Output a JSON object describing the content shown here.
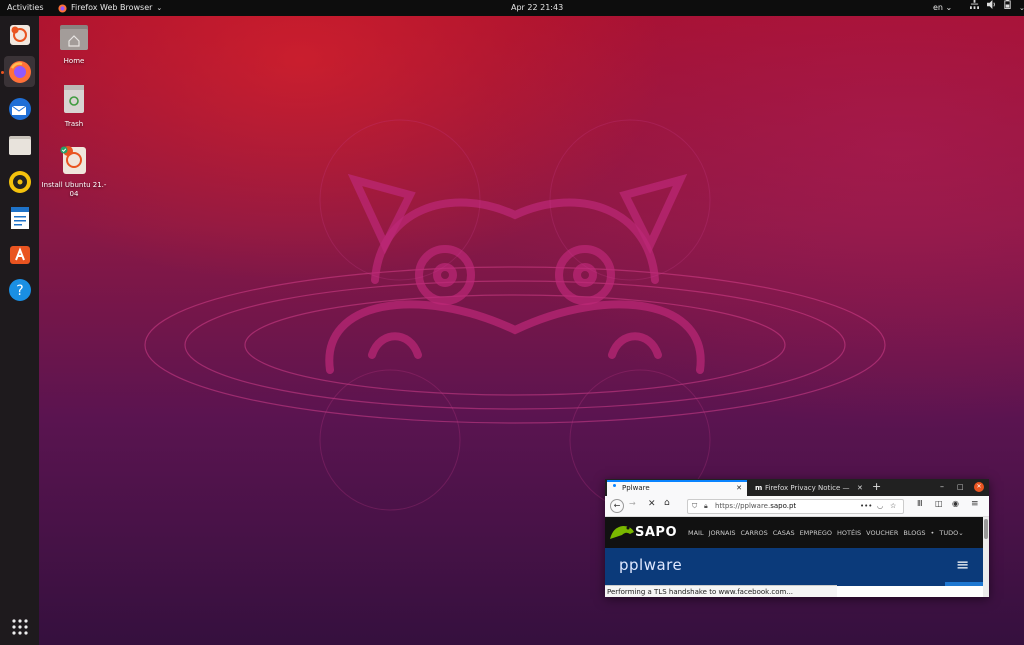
{
  "topbar": {
    "activities": "Activities",
    "app_name": "Firefox Web Browser",
    "clock": "Apr 22  21:43",
    "language": "en"
  },
  "desktop": {
    "icons": [
      {
        "label": "Home",
        "icon": "folder-home-icon"
      },
      {
        "label": "Trash",
        "icon": "trash-icon"
      },
      {
        "label": "Install Ubuntu 21.-\n04",
        "icon": "ubuntu-installer-icon"
      }
    ]
  },
  "dock": {
    "items": [
      "ubuntu-installer",
      "firefox",
      "thunderbird",
      "files",
      "rhythmbox",
      "libreoffice-writer",
      "ubuntu-software",
      "help"
    ],
    "show_apps": "show-applications-icon"
  },
  "firefox": {
    "tabs": [
      {
        "label": "Pplware",
        "active": true
      },
      {
        "label": "Firefox Privacy Notice —",
        "active": false
      }
    ],
    "new_tab": "+",
    "url_prefix": "https://pplware.",
    "url_domain": "sapo.pt",
    "sapo_logo": "SAPO",
    "sapo_menu": [
      "MAIL",
      "JORNAIS",
      "CARROS",
      "CASAS",
      "EMPREGO",
      "HOTÉIS",
      "VOUCHER",
      "BLOGS",
      "•",
      "TUDO"
    ],
    "site_logo": "pplware",
    "status": "Performing a TLS handshake to www.facebook.com..."
  },
  "colors": {
    "accent": "#e95420",
    "topbar": "#0d0d0d",
    "dock": "#1e1a1d",
    "firefox_blue": "#0a84ff",
    "pplware_blue": "#0b3a7a",
    "sapo_green": "#7ab800"
  }
}
